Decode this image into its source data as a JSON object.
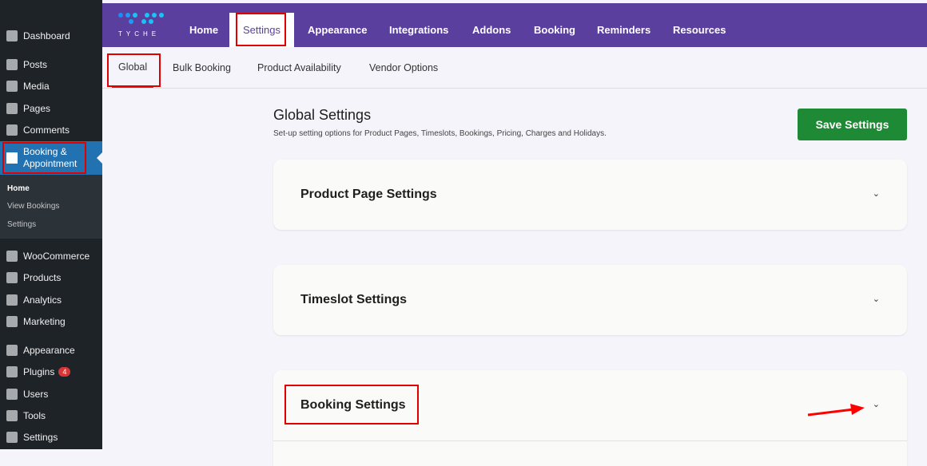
{
  "sidebar": {
    "items": [
      "Dashboard",
      "Posts",
      "Media",
      "Pages",
      "Comments"
    ],
    "booking": "Booking & Appointment",
    "sub": [
      "Home",
      "View Bookings",
      "Settings"
    ],
    "items2": [
      "WooCommerce",
      "Products",
      "Analytics",
      "Marketing",
      "Appearance",
      "Plugins",
      "Users",
      "Tools",
      "Settings"
    ],
    "plugins_badge": "4"
  },
  "logo": {
    "text": "TYCHE"
  },
  "tabs": [
    "Home",
    "Settings",
    "Appearance",
    "Integrations",
    "Addons",
    "Booking",
    "Reminders",
    "Resources"
  ],
  "subtabs": [
    "Global",
    "Bulk Booking",
    "Product Availability",
    "Vendor Options"
  ],
  "page": {
    "title": "Global Settings",
    "description": "Set-up setting options for Product Pages, Timeslots, Bookings, Pricing, Charges and Holidays.",
    "save": "Save Settings"
  },
  "sections": [
    "Product Page Settings",
    "Timeslot Settings",
    "Booking Settings"
  ],
  "colors": {
    "accent": "#5b3f9e",
    "save": "#1e8a35",
    "highlight": "#e00000"
  }
}
